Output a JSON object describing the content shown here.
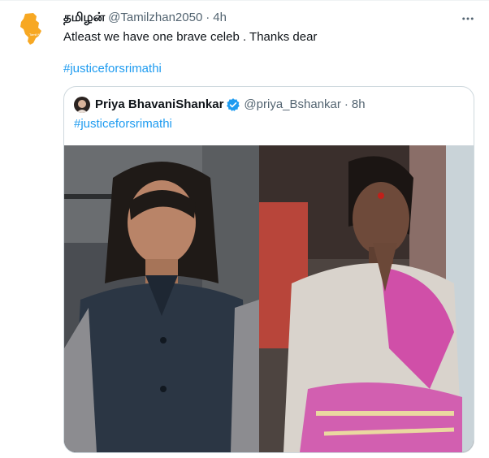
{
  "tweet": {
    "author_name": "தமிழன்",
    "author_handle": "@Tamilzhan2050",
    "separator": "·",
    "time": "4h",
    "text": "Atleast we have one brave celeb . Thanks dear",
    "hashtag": "#justiceforsrimathi",
    "more_icon": "more-horizontal-icon"
  },
  "quote": {
    "author_name": "Priya BhavaniShankar",
    "author_handle": "@priya_Bshankar",
    "separator": "·",
    "time": "8h",
    "text": "#justiceforsrimathi",
    "verified_icon": "verified-badge-icon",
    "media": [
      "student photo",
      "woman with folded hands"
    ]
  },
  "colors": {
    "accent": "#1d9bf0",
    "secondary_text": "#536471",
    "border": "#cfd9de",
    "avatar_orange": "#f7a823"
  }
}
